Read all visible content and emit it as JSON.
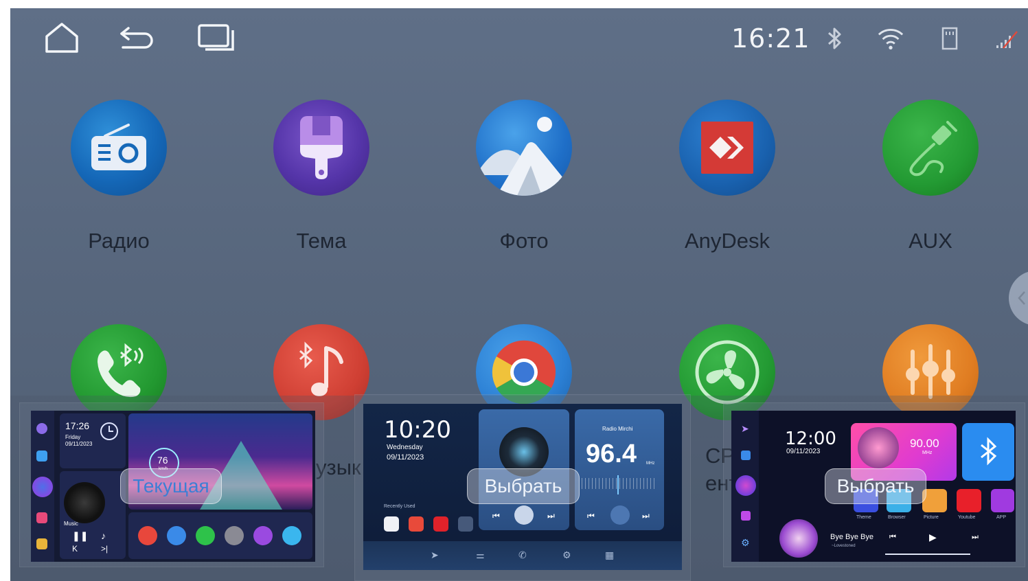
{
  "status": {
    "time": "16:21",
    "icons": [
      "bluetooth-icon",
      "wifi-icon",
      "sd-card-icon",
      "signal-icon"
    ]
  },
  "nav": [
    "home-icon",
    "back-icon",
    "recents-icon"
  ],
  "apps": [
    {
      "label": "Радио",
      "icon": "radio-icon"
    },
    {
      "label": "Тема",
      "icon": "theme-brush-icon"
    },
    {
      "label": "Фото",
      "icon": "photo-icon"
    },
    {
      "label": "AnyDesk",
      "icon": "anydesk-icon"
    },
    {
      "label": "AUX",
      "icon": "aux-cable-icon"
    },
    {
      "label": "",
      "icon": "bluetooth-phone-icon"
    },
    {
      "label": "узык",
      "icon": "bluetooth-music-icon"
    },
    {
      "label": "",
      "icon": "chrome-icon"
    },
    {
      "label": "CP\nенти.",
      "icon": "fan-icon"
    },
    {
      "label": "",
      "icon": "equalizer-icon"
    }
  ],
  "themes": [
    {
      "button": "Текущая",
      "time": "17:26",
      "day": "Friday",
      "date": "09/11/2023",
      "speed": "76",
      "speed_unit": "km/h",
      "music_label": "Music"
    },
    {
      "button": "Выбрать",
      "time": "10:20",
      "day": "Wednesday",
      "date": "09/11/2023",
      "recent_label": "Recently Used",
      "station": "Radio Mirchi",
      "frequency": "96.4",
      "freq_unit": "MHz"
    },
    {
      "button": "Выбрать",
      "time": "12:00",
      "date": "09/11/2023",
      "frequency": "90.00",
      "freq_unit": "MHz",
      "song": "Bye Bye Bye",
      "artist": "~Lovestoned",
      "shortcuts": [
        "Theme",
        "Browser",
        "Picture",
        "Youtube",
        "APP"
      ]
    }
  ],
  "colors": {
    "screen_bg": "#5a697f",
    "label_text": "#1e2633",
    "current_pill_text": "#3d7fd4"
  }
}
